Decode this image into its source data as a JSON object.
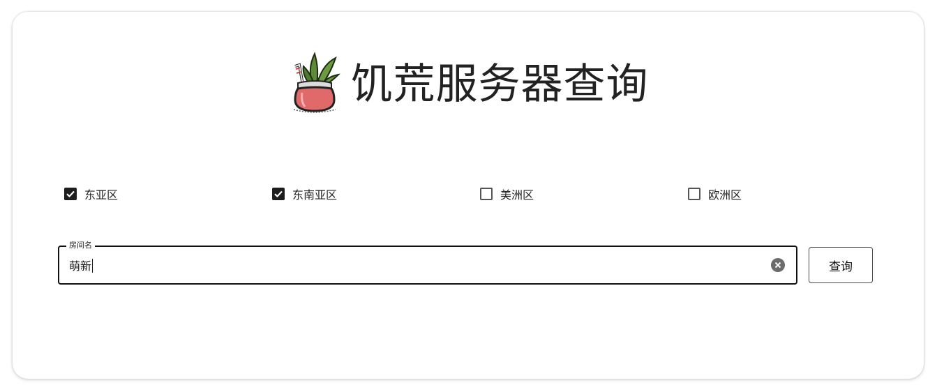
{
  "header": {
    "title": "饥荒服务器查询",
    "logo_icon": "radish-jar-logo"
  },
  "regions": [
    {
      "label": "东亚区",
      "checked": true
    },
    {
      "label": "东南亚区",
      "checked": true
    },
    {
      "label": "美洲区",
      "checked": false
    },
    {
      "label": "欧洲区",
      "checked": false
    }
  ],
  "search": {
    "label": "房间名",
    "value": "萌新",
    "clear_icon": "clear-circle-icon"
  },
  "query_button": {
    "label": "查询"
  },
  "colors": {
    "text": "#222222",
    "checkbox_checked": "#1d1d1d",
    "field_border": "#111111",
    "clear_icon": "#6b6b6b"
  }
}
